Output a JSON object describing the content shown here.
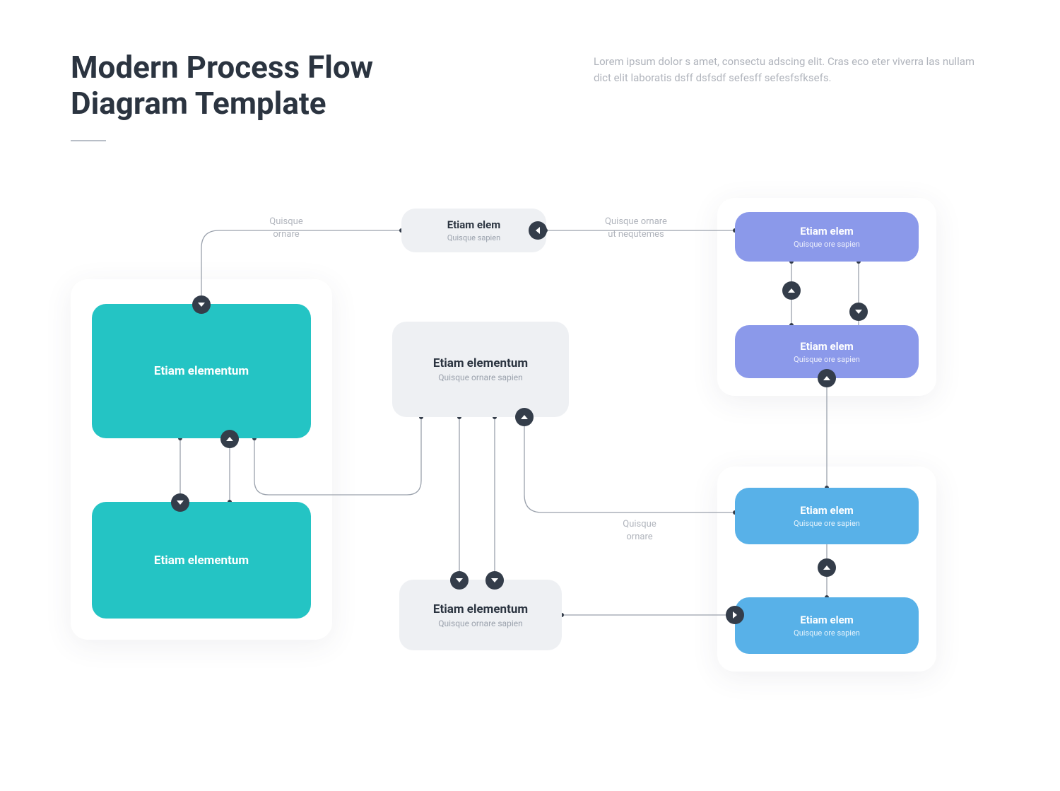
{
  "header": {
    "title": "Modern Process Flow Diagram Template",
    "description": "Lorem ipsum dolor s amet, consectu adscing elit. Cras eco eter viverra las nullam dict elit laboratis dsff dsfsdf sefesff sefesfsfksefs."
  },
  "nodes": {
    "teal1": {
      "title": "Etiam elementum",
      "subtitle": ""
    },
    "teal2": {
      "title": "Etiam elementum",
      "subtitle": ""
    },
    "grey_top": {
      "title": "Etiam elem",
      "subtitle": "Quisque sapien"
    },
    "grey_mid": {
      "title": "Etiam elementum",
      "subtitle": "Quisque ornare sapien"
    },
    "grey_bot": {
      "title": "Etiam elementum",
      "subtitle": "Quisque ornare sapien"
    },
    "purple1": {
      "title": "Etiam elem",
      "subtitle": "Quisque ore sapien"
    },
    "purple2": {
      "title": "Etiam elem",
      "subtitle": "Quisque ore sapien"
    },
    "blue1": {
      "title": "Etiam elem",
      "subtitle": "Quisque ore sapien"
    },
    "blue2": {
      "title": "Etiam elem",
      "subtitle": "Quisque ore sapien"
    }
  },
  "edge_labels": {
    "l1": "Quisque ornare",
    "l2": "Quisque ornare ut nequtemes",
    "l3": "Quisque ornare"
  },
  "colors": {
    "teal": "#24c4c4",
    "grey": "#eef0f3",
    "purple": "#8b99ea",
    "blue": "#58b1e8",
    "ink": "#2b3440",
    "muted": "#b0b4bc"
  }
}
